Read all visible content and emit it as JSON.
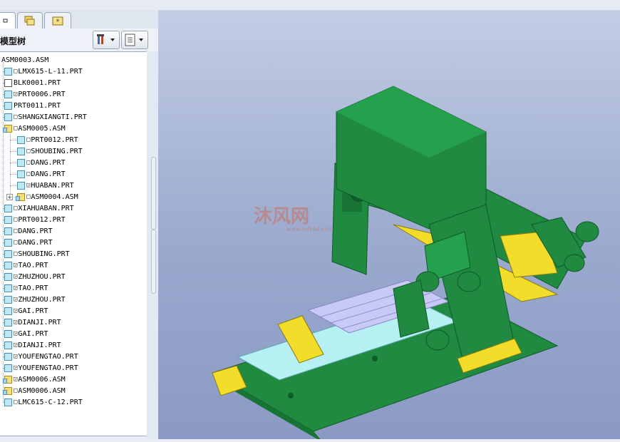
{
  "panel": {
    "title": "模型树",
    "tabs": [
      {
        "name": "model-tree-tab",
        "icon": "tree-icon"
      },
      {
        "name": "folder-browser-tab",
        "icon": "folders-icon"
      },
      {
        "name": "favorites-tab",
        "icon": "favorites-icon"
      }
    ],
    "toolbar": [
      {
        "name": "settings-dropdown",
        "icon": "tools-icon"
      },
      {
        "name": "show-dropdown",
        "icon": "list-icon"
      }
    ]
  },
  "tree": {
    "root": "ASM0003.ASM",
    "items": [
      {
        "label": "LMX615-L-11.PRT",
        "type": "part",
        "flag": "□",
        "level": 0
      },
      {
        "label": "BLK0001.PRT",
        "type": "blk",
        "flag": "",
        "level": 0
      },
      {
        "label": "PRT0006.PRT",
        "type": "part",
        "flag": "◲",
        "level": 0
      },
      {
        "label": "PRT0011.PRT",
        "type": "part",
        "flag": "",
        "level": 0
      },
      {
        "label": "SHANGXIANGTI.PRT",
        "type": "part",
        "flag": "□",
        "level": 0
      },
      {
        "label": "ASM0005.ASM",
        "type": "asm",
        "flag": "□",
        "level": 0
      },
      {
        "label": "PRT0012.PRT",
        "type": "part",
        "flag": "□",
        "level": 1
      },
      {
        "label": "SHOUBING.PRT",
        "type": "part",
        "flag": "□",
        "level": 1
      },
      {
        "label": "DANG.PRT",
        "type": "part",
        "flag": "□",
        "level": 1
      },
      {
        "label": "DANG.PRT",
        "type": "part",
        "flag": "□",
        "level": 1
      },
      {
        "label": "HUABAN.PRT",
        "type": "part",
        "flag": "◲",
        "level": 1
      },
      {
        "label": "ASM0004.ASM",
        "type": "asm",
        "flag": "□",
        "level": 1
      },
      {
        "label": "XIAHUABAN.PRT",
        "type": "part",
        "flag": "□",
        "level": 0
      },
      {
        "label": "PRT0012.PRT",
        "type": "part",
        "flag": "□",
        "level": 0
      },
      {
        "label": "DANG.PRT",
        "type": "part",
        "flag": "□",
        "level": 0
      },
      {
        "label": "DANG.PRT",
        "type": "part",
        "flag": "□",
        "level": 0
      },
      {
        "label": "SHOUBING.PRT",
        "type": "part",
        "flag": "□",
        "level": 0
      },
      {
        "label": "TAO.PRT",
        "type": "part",
        "flag": "◲",
        "level": 0
      },
      {
        "label": "ZHUZHOU.PRT",
        "type": "part",
        "flag": "◲",
        "level": 0
      },
      {
        "label": "TAO.PRT",
        "type": "part",
        "flag": "◲",
        "level": 0
      },
      {
        "label": "ZHUZHOU.PRT",
        "type": "part",
        "flag": "◲",
        "level": 0
      },
      {
        "label": "GAI.PRT",
        "type": "part",
        "flag": "◲",
        "level": 0
      },
      {
        "label": "DIANJI.PRT",
        "type": "part",
        "flag": "◲",
        "level": 0
      },
      {
        "label": "GAI.PRT",
        "type": "part",
        "flag": "◲",
        "level": 0
      },
      {
        "label": "DIANJI.PRT",
        "type": "part",
        "flag": "◲",
        "level": 0
      },
      {
        "label": "YOUFENGTAO.PRT",
        "type": "part",
        "flag": "◲",
        "level": 0
      },
      {
        "label": "YOUFENGTAO.PRT",
        "type": "part",
        "flag": "◲",
        "level": 0
      },
      {
        "label": "ASM0006.ASM",
        "type": "asm",
        "flag": "◲",
        "level": 0
      },
      {
        "label": "ASM0006.ASM",
        "type": "asm",
        "flag": "□",
        "level": 0
      },
      {
        "label": "LMC615-C-12.PRT",
        "type": "part",
        "flag": "□",
        "level": 0
      }
    ]
  },
  "viewport": {
    "watermark": "沐风网",
    "watermark_sub": "www.mfcad.com",
    "colors": {
      "body": "#1f8a40",
      "dark": "#0f5a28",
      "rail": "#b6f0f2",
      "yellow": "#f2de2a",
      "table": "#c9c9f5"
    }
  }
}
